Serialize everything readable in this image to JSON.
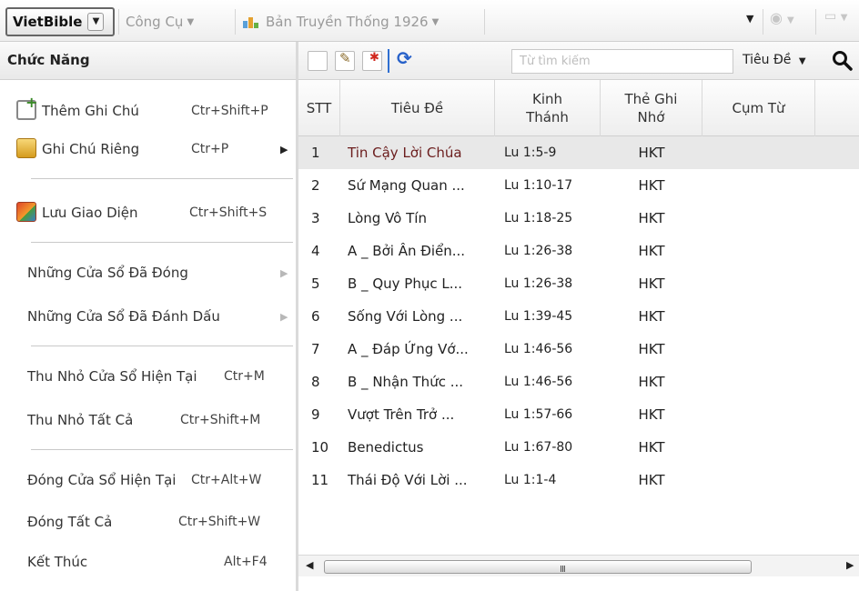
{
  "toolbar": {
    "app_menu": "VietBible",
    "tools_menu": "Công Cụ",
    "version_menu": "Bản Truyền Thống 1926"
  },
  "panel": {
    "title": "Chức Năng",
    "items": [
      {
        "label": "Thêm Ghi Chú",
        "shortcut": "Ctr+Shift+P",
        "icon": "add-note-icon"
      },
      {
        "label": "Ghi Chú Riêng",
        "shortcut": "Ctr+P",
        "icon": "folder-note-icon",
        "submenu": true
      },
      {
        "label": "Lưu Giao Diện",
        "shortcut": "Ctr+Shift+S",
        "icon": "save-layout-icon"
      },
      {
        "label": "Những Cửa Sổ Đã Đóng",
        "shortcut": "",
        "submenu": true
      },
      {
        "label": "Những Cửa Sổ Đã Đánh Dấu",
        "shortcut": "",
        "submenu": true
      },
      {
        "label": "Thu Nhỏ Cửa Sổ Hiện Tại",
        "shortcut": "Ctr+M"
      },
      {
        "label": "Thu Nhỏ Tất Cả",
        "shortcut": "Ctr+Shift+M"
      },
      {
        "label": "Đóng Cửa Sổ Hiện Tại",
        "shortcut": "Ctr+Alt+W"
      },
      {
        "label": "Đóng Tất Cả",
        "shortcut": "Ctr+Shift+W"
      },
      {
        "label": "Kết Thúc",
        "shortcut": "Alt+F4"
      }
    ]
  },
  "search": {
    "placeholder": "Từ tìm kiếm",
    "scope": "Tiêu Đề"
  },
  "table": {
    "columns": {
      "stt": "STT",
      "title": "Tiêu Đề",
      "ref_line1": "Kinh",
      "ref_line2": "Thánh",
      "tag_line1": "Thẻ Ghi",
      "tag_line2": "Nhớ",
      "phrase": "Cụm Từ"
    },
    "rows": [
      {
        "stt": "1",
        "title": "Tin Cậy Lời Chúa",
        "ref": "Lu 1:5-9",
        "tag": "HKT"
      },
      {
        "stt": "2",
        "title": "Sứ Mạng Quan ...",
        "ref": "Lu 1:10-17",
        "tag": "HKT"
      },
      {
        "stt": "3",
        "title": "Lòng Vô Tín",
        "ref": "Lu 1:18-25",
        "tag": "HKT"
      },
      {
        "stt": "4",
        "title": "A _ Bởi Ân Điển...",
        "ref": "Lu 1:26-38",
        "tag": "HKT"
      },
      {
        "stt": "5",
        "title": "B _ Quy Phục L...",
        "ref": "Lu 1:26-38",
        "tag": "HKT"
      },
      {
        "stt": "6",
        "title": "Sống Với Lòng ...",
        "ref": "Lu 1:39-45",
        "tag": "HKT"
      },
      {
        "stt": "7",
        "title": "A _ Đáp Ứng Vớ...",
        "ref": "Lu 1:46-56",
        "tag": "HKT"
      },
      {
        "stt": "8",
        "title": "B _ Nhận Thức ...",
        "ref": "Lu 1:46-56",
        "tag": "HKT"
      },
      {
        "stt": "9",
        "title": "Vượt Trên Trở ...",
        "ref": "Lu 1:57-66",
        "tag": "HKT"
      },
      {
        "stt": "10",
        "title": "Benedictus",
        "ref": "Lu 1:67-80",
        "tag": "HKT"
      },
      {
        "stt": "11",
        "title": "Thái Độ Với Lời ...",
        "ref": "Lu 1:1-4",
        "tag": "HKT"
      }
    ]
  },
  "scrollbar": {
    "grip": "III"
  }
}
